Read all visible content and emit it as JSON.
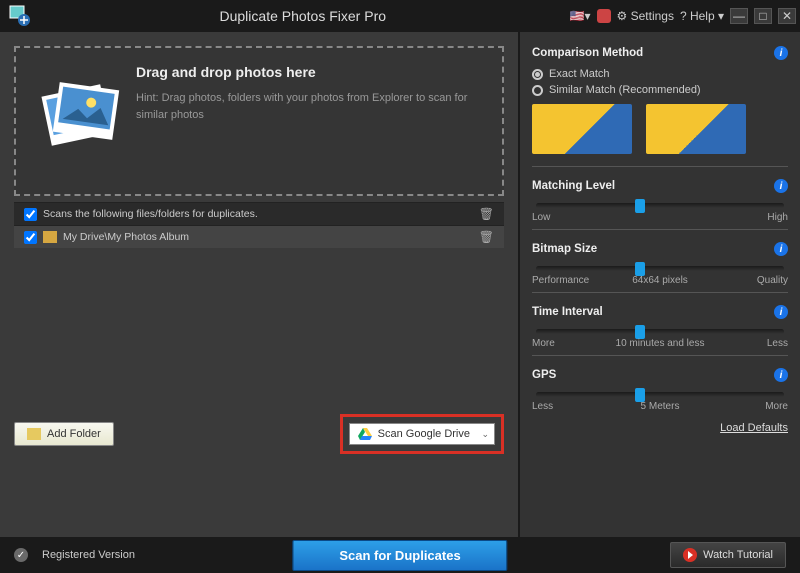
{
  "titlebar": {
    "app_title": "Duplicate Photos Fixer Pro",
    "settings": "Settings",
    "help": "? Help"
  },
  "dropzone": {
    "heading": "Drag and drop photos here",
    "hint": "Hint: Drag photos, folders with your photos from Explorer to scan for similar photos"
  },
  "filelist": {
    "header": "Scans the following files/folders for duplicates.",
    "items": [
      {
        "label": "My Drive\\My Photos Album"
      }
    ]
  },
  "buttons": {
    "add_folder": "Add Folder",
    "scan_gdrive": "Scan Google Drive",
    "scan_duplicates": "Scan for Duplicates",
    "watch_tutorial": "Watch Tutorial"
  },
  "sidebar": {
    "comparison_method": "Comparison Method",
    "exact_match": "Exact Match",
    "similar_match": "Similar Match (Recommended)",
    "matching_level": {
      "title": "Matching Level",
      "low": "Low",
      "high": "High"
    },
    "bitmap_size": {
      "title": "Bitmap Size",
      "low": "Performance",
      "mid": "64x64 pixels",
      "high": "Quality"
    },
    "time_interval": {
      "title": "Time Interval",
      "low": "More",
      "mid": "10 minutes and less",
      "high": "Less"
    },
    "gps": {
      "title": "GPS",
      "low": "Less",
      "mid": "5 Meters",
      "high": "More"
    },
    "load_defaults": "Load Defaults"
  },
  "footer": {
    "registered": "Registered Version"
  }
}
